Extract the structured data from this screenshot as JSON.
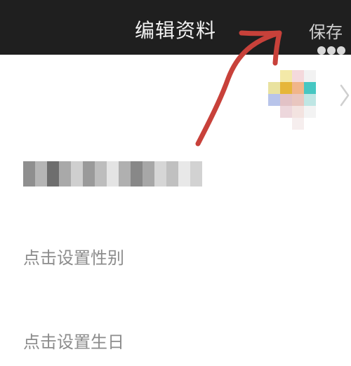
{
  "header": {
    "title": "编辑资料",
    "save_label": "保存"
  },
  "profile": {
    "gender_placeholder": "点击设置性别",
    "birthday_placeholder": "点击设置生日"
  },
  "colors": {
    "header_bg": "#1f1f1f",
    "annotation_arrow": "#c8413a",
    "placeholder_text": "#8c8c8c"
  }
}
